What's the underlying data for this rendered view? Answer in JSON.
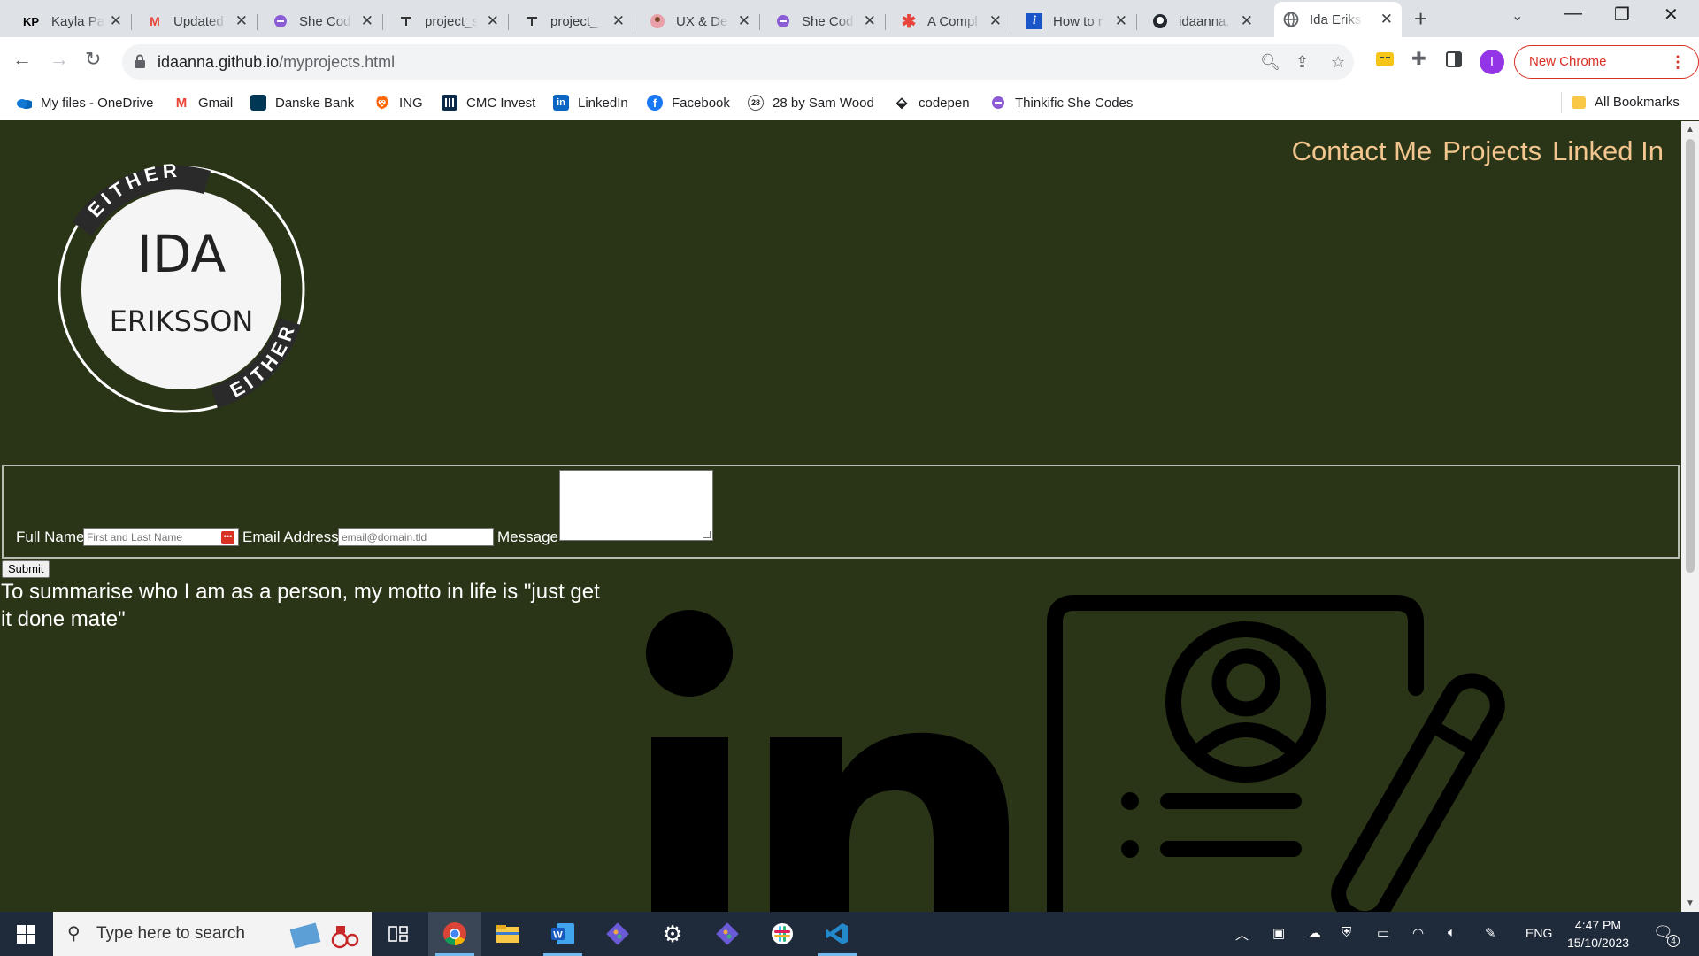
{
  "browser": {
    "tabs": [
      {
        "title": "Kayla Pa",
        "icon": "kp-icon"
      },
      {
        "title": "Updated",
        "icon": "gmail-icon"
      },
      {
        "title": "She Cod",
        "icon": "shecodes-icon"
      },
      {
        "title": "project_s",
        "icon": "git-icon"
      },
      {
        "title": "project_",
        "icon": "git-icon"
      },
      {
        "title": "UX & De",
        "icon": "avatar-icon"
      },
      {
        "title": "She Cod",
        "icon": "shecodes-icon"
      },
      {
        "title": "A Compl",
        "icon": "asterisk-icon"
      },
      {
        "title": "How to r",
        "icon": "info-icon"
      },
      {
        "title": "idaanna.",
        "icon": "github-icon"
      },
      {
        "title": "Ida Eriks",
        "icon": "globe-icon",
        "active": true
      }
    ],
    "url_host": "idaanna.github.io",
    "url_path": "/myprojects.html",
    "update_label": "New Chrome available",
    "profile_initial": "I",
    "bookmarks": [
      {
        "label": "My files - OneDrive",
        "icon": "onedrive-icon"
      },
      {
        "label": "Gmail",
        "icon": "gmail-icon"
      },
      {
        "label": "Danske Bank",
        "icon": "danske-bank-icon"
      },
      {
        "label": "ING",
        "icon": "ing-icon"
      },
      {
        "label": "CMC Invest",
        "icon": "cmc-icon"
      },
      {
        "label": "LinkedIn",
        "icon": "linkedin-icon"
      },
      {
        "label": "Facebook",
        "icon": "facebook-icon"
      },
      {
        "label": "28 by Sam Wood",
        "icon": "sam-wood-icon"
      },
      {
        "label": "codepen",
        "icon": "codepen-icon"
      },
      {
        "label": "Thinkific She Codes",
        "icon": "thinkific-icon"
      }
    ],
    "all_bookmarks_label": "All Bookmarks"
  },
  "page": {
    "nav": [
      "Contact Me",
      "Projects",
      "Linked In"
    ],
    "logo": {
      "name_top": "IDA",
      "name_bottom": "ERIKSSON",
      "arc_text": "EITHER"
    },
    "form": {
      "full_name_label": "Full Name",
      "full_name_placeholder": "First and Last Name",
      "email_label": "Email Address",
      "email_placeholder": "email@domain.tld",
      "message_label": "Message",
      "submit_label": "Submit"
    },
    "motto": "To summarise who I am as a person, my motto in life is \"just get it done mate\""
  },
  "taskbar": {
    "search_placeholder": "Type here to search",
    "apps": [
      "chrome-icon",
      "file-explorer-icon",
      "word-icon",
      "git-icon",
      "settings-icon",
      "git-icon",
      "slack-icon",
      "vscode-icon"
    ],
    "language": "ENG",
    "time": "4:47 PM",
    "date": "15/10/2023",
    "notification_count": "4"
  },
  "colors": {
    "page_background": "#2a3518",
    "nav_link": "#f2c68e",
    "chrome_update": "#d93025"
  }
}
